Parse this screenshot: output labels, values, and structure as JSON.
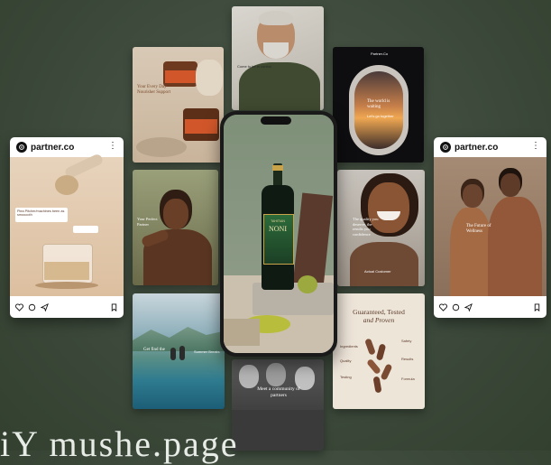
{
  "posts": {
    "left": {
      "brand": "partner.co",
      "menu": "⋮",
      "tile_text": "Plea Pitcher/machines been as smooooth"
    },
    "right": {
      "brand": "partner.co",
      "menu": "⋮",
      "tile_text": "The Future of Wellness"
    }
  },
  "tiles": {
    "jar_text": "Your Every Day Nourisher Support",
    "man_text": "Come to be in control",
    "window_brand": "Partner.Co",
    "window_text": "The world is waiting",
    "window_sub": "Let's go together",
    "woman_text": "Your Perfect Partner",
    "smiling_text": "The quality you deserve, the results you confidence",
    "smiling_sub": "Actual Customer",
    "pool_text": "Get find the",
    "pool_sub": "Summer Breaks",
    "community_text": "Meet a community of partners",
    "pills_title_1": "Guaranteed, Tested",
    "pills_title_2": "and Proven",
    "pills_labels": [
      "Ingredients",
      "Quality",
      "Testing",
      "Safety",
      "Results",
      "Formula"
    ]
  },
  "phone": {
    "bottle_brand": "NONI",
    "bottle_sub": "TAHITIAN"
  },
  "bottom_text": "iY mushe.page"
}
